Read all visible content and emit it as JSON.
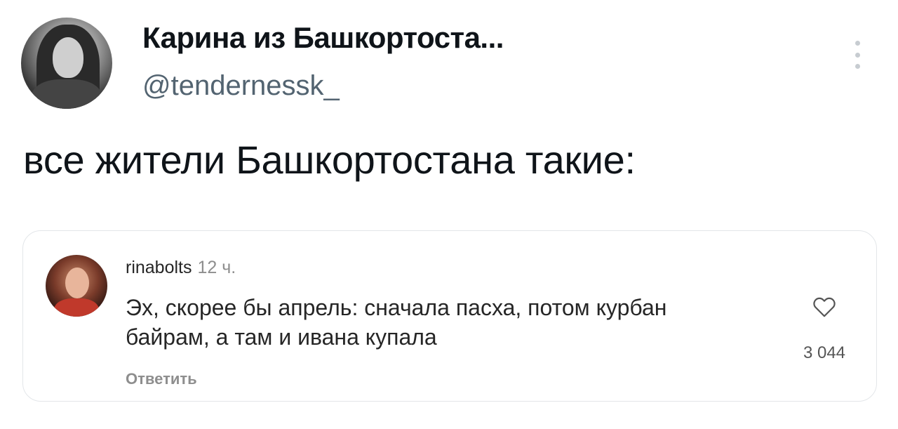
{
  "tweet": {
    "author_name": "Карина из Башкортоста...",
    "author_handle": "@tendernessk_",
    "text": "все жители Башкортостана такие:"
  },
  "comment": {
    "username": "rinabolts",
    "time": "12 ч.",
    "text": "Эх, скорее бы апрель: сначала пасха, потом курбан байрам, а там и ивана купала",
    "reply_label": "Ответить",
    "likes": "3 044",
    "like_icon": "heart-icon"
  },
  "colors": {
    "secondary_text": "#536471",
    "card_border": "#e3e6e9",
    "muted_text": "#8e8e8e"
  }
}
